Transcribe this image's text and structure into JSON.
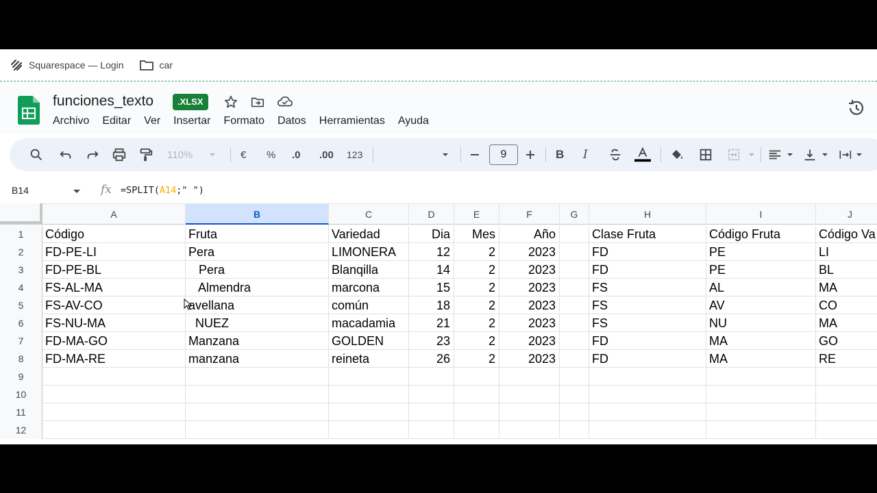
{
  "bookmarks": [
    {
      "label": "Squarespace — Login",
      "icon": "squarespace-icon"
    },
    {
      "label": "car",
      "icon": "folder-icon"
    }
  ],
  "doc": {
    "title": "funciones_texto",
    "badge": ".XLSX"
  },
  "menu": [
    "Archivo",
    "Editar",
    "Ver",
    "Insertar",
    "Formato",
    "Datos",
    "Herramientas",
    "Ayuda"
  ],
  "toolbar": {
    "zoom": "110%",
    "currency": "€",
    "percent": "%",
    "dec_less": ".0",
    "dec_more": ".00",
    "number_format": "123",
    "font_size": "9"
  },
  "formula_bar": {
    "cell_ref": "B14",
    "fx": "fx",
    "formula_prefix": "=SPLIT(",
    "formula_ref": "A14",
    "formula_suffix": ";\" \")"
  },
  "columns": [
    "A",
    "B",
    "C",
    "D",
    "E",
    "F",
    "G",
    "H",
    "I",
    "J"
  ],
  "selected_column": "B",
  "rows": [
    {
      "n": "1",
      "cells": [
        "Código",
        "Fruta",
        "Variedad",
        "Dia",
        "Mes",
        "Año",
        "",
        "Clase Fruta",
        "Código Fruta",
        "Código Va"
      ]
    },
    {
      "n": "2",
      "cells": [
        "FD-PE-LI",
        "Pera",
        "LIMONERA",
        "12",
        "2",
        "2023",
        "",
        "FD",
        "PE",
        "LI"
      ]
    },
    {
      "n": "3",
      "cells": [
        "FD-PE-BL",
        "   Pera",
        "Blanqilla",
        "14",
        "2",
        "2023",
        "",
        "FD",
        "PE",
        "BL"
      ]
    },
    {
      "n": "4",
      "cells": [
        "FS-AL-MA",
        "   Almendra",
        "marcona",
        "15",
        "2",
        "2023",
        "",
        "FS",
        "AL",
        "MA"
      ]
    },
    {
      "n": "5",
      "cells": [
        "FS-AV-CO",
        "avellana",
        "común",
        "18",
        "2",
        "2023",
        "",
        "FS",
        "AV",
        "CO"
      ]
    },
    {
      "n": "6",
      "cells": [
        "FS-NU-MA",
        "  NUEZ",
        "macadamia",
        "21",
        "2",
        "2023",
        "",
        "FS",
        "NU",
        "MA"
      ]
    },
    {
      "n": "7",
      "cells": [
        "FD-MA-GO",
        "Manzana",
        "GOLDEN",
        "23",
        "2",
        "2023",
        "",
        "FD",
        "MA",
        "GO"
      ]
    },
    {
      "n": "8",
      "cells": [
        "FD-MA-RE",
        "manzana",
        "reineta",
        "26",
        "2",
        "2023",
        "",
        "FD",
        "MA",
        "RE"
      ]
    },
    {
      "n": "9",
      "cells": [
        "",
        "",
        "",
        "",
        "",
        "",
        "",
        "",
        "",
        ""
      ]
    },
    {
      "n": "10",
      "cells": [
        "",
        "",
        "",
        "",
        "",
        "",
        "",
        "",
        "",
        ""
      ]
    },
    {
      "n": "11",
      "cells": [
        "",
        "",
        "",
        "",
        "",
        "",
        "",
        "",
        "",
        ""
      ]
    },
    {
      "n": "12",
      "cells": [
        "",
        "",
        "",
        "",
        "",
        "",
        "",
        "",
        "",
        ""
      ]
    }
  ],
  "colors": {
    "brand_green": "#188038",
    "selected_col": "#d3e3fd",
    "formula_ref": "#f9ab00"
  }
}
